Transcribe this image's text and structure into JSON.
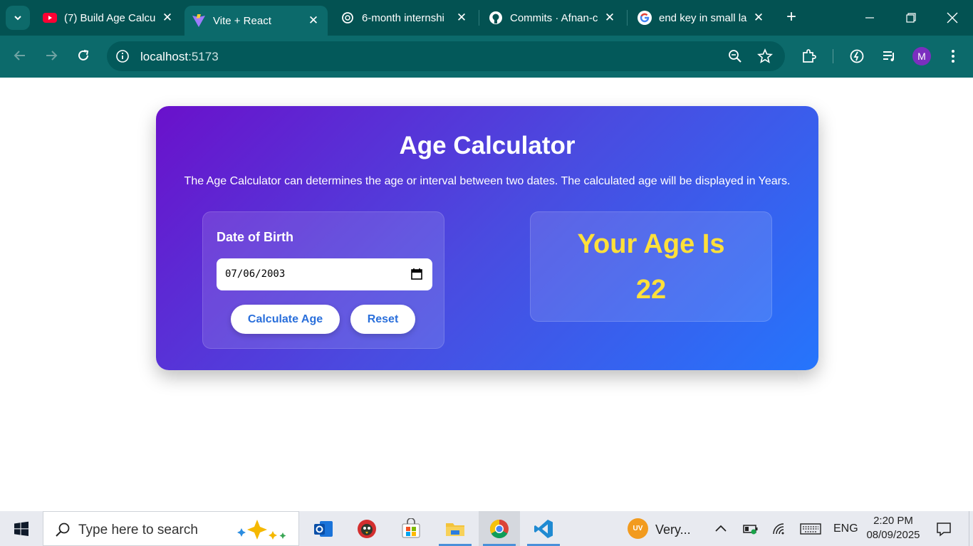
{
  "browser": {
    "tabs": [
      {
        "title": "(7) Build Age Calcu",
        "icon": "youtube-icon"
      },
      {
        "title": "Vite + React",
        "icon": "vite-icon",
        "active": true
      },
      {
        "title": "6-month internshi",
        "icon": "chatgpt-icon"
      },
      {
        "title": "Commits · Afnan-c",
        "icon": "github-icon"
      },
      {
        "title": "end key in small la",
        "icon": "google-icon"
      }
    ],
    "url_host": "localhost",
    "url_port": ":5173",
    "profile_initial": "M"
  },
  "app": {
    "title": "Age Calculator",
    "description": "The Age Calculator can determines the age or interval between two dates. The calculated age will be displayed in Years.",
    "dob_label": "Date of Birth",
    "dob_value": "07/06/2003",
    "calculate_label": "Calculate Age",
    "reset_label": "Reset",
    "result_label": "Your Age Is",
    "result_value": "22"
  },
  "taskbar": {
    "search_placeholder": "Type here to search",
    "weather_text": "Very...",
    "weather_badge": "UV",
    "language": "ENG",
    "time": "2:20 PM",
    "date": "08/09/2025"
  },
  "colors": {
    "browser_frame": "#035252",
    "gradient_start": "#6a11cb",
    "gradient_end": "#2575fc",
    "result_text": "#ffe03a",
    "button_text": "#2a6fdb"
  }
}
